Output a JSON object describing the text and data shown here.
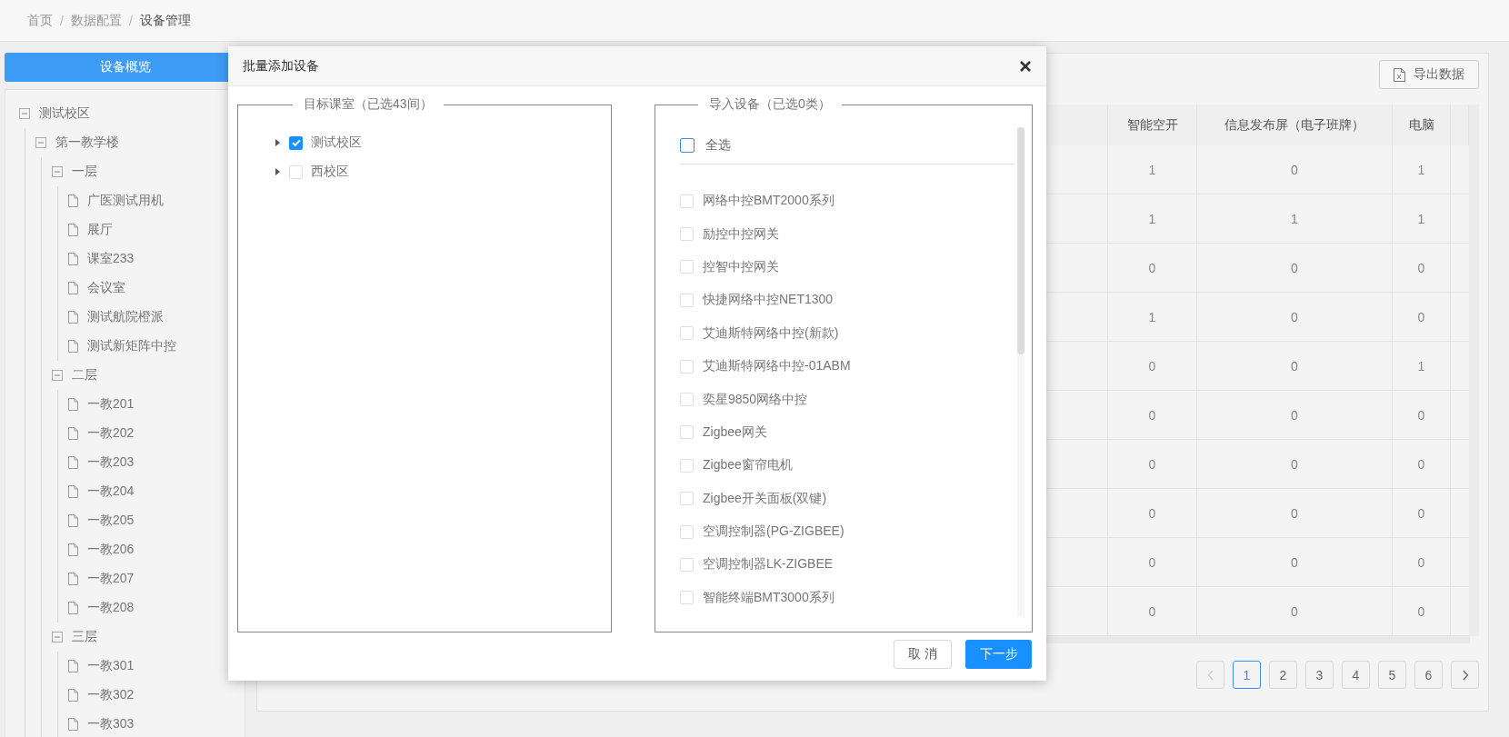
{
  "breadcrumb": [
    {
      "kind": "link",
      "text": "首页"
    },
    {
      "kind": "separator",
      "text": "/"
    },
    {
      "kind": "link",
      "text": "数据配置"
    },
    {
      "kind": "separator",
      "text": "/"
    },
    {
      "kind": "current",
      "text": "设备管理"
    }
  ],
  "sidebar": {
    "button": "设备概览",
    "tree": [
      {
        "label": "测试校区",
        "expanded": true,
        "children": [
          {
            "label": "第一教学楼",
            "expanded": true,
            "children": [
              {
                "label": "一层",
                "expanded": true,
                "children": [
                  {
                    "label": "广医测试用机"
                  },
                  {
                    "label": "展厅"
                  },
                  {
                    "label": "课室233"
                  },
                  {
                    "label": "会议室"
                  },
                  {
                    "label": "测试航院橙派"
                  },
                  {
                    "label": "测试新矩阵中控"
                  }
                ]
              },
              {
                "label": "二层",
                "expanded": true,
                "children": [
                  {
                    "label": "一教201"
                  },
                  {
                    "label": "一教202"
                  },
                  {
                    "label": "一教203"
                  },
                  {
                    "label": "一教204"
                  },
                  {
                    "label": "一教205"
                  },
                  {
                    "label": "一教206"
                  },
                  {
                    "label": "一教207"
                  },
                  {
                    "label": "一教208"
                  }
                ]
              },
              {
                "label": "三层",
                "expanded": true,
                "children": [
                  {
                    "label": "一教301"
                  },
                  {
                    "label": "一教302"
                  },
                  {
                    "label": "一教303"
                  }
                ]
              }
            ]
          }
        ]
      }
    ]
  },
  "panel": {
    "export_button": "导出数据",
    "table": {
      "columns": [
        "智能空开",
        "信息发布屏（电子班牌）",
        "电脑"
      ],
      "rows": [
        [
          "1",
          "0",
          "1"
        ],
        [
          "1",
          "1",
          "1"
        ],
        [
          "0",
          "0",
          "0"
        ],
        [
          "1",
          "0",
          "0"
        ],
        [
          "0",
          "0",
          "1"
        ],
        [
          "0",
          "0",
          "0"
        ],
        [
          "0",
          "0",
          "0"
        ],
        [
          "0",
          "0",
          "0"
        ],
        [
          "0",
          "0",
          "0"
        ],
        [
          "0",
          "0",
          "0"
        ]
      ]
    },
    "pagination": {
      "prev": {
        "disabled": true
      },
      "next": {
        "disabled": false
      },
      "pages": [
        {
          "label": "1",
          "selected": true
        },
        {
          "label": "2",
          "selected": false
        },
        {
          "label": "3",
          "selected": false
        },
        {
          "label": "4",
          "selected": false
        },
        {
          "label": "5",
          "selected": false
        },
        {
          "label": "6",
          "selected": false
        }
      ]
    }
  },
  "modal": {
    "title": "批量添加设备",
    "rooms": {
      "legend": "目标课室（已选43间）",
      "tree": [
        {
          "label": "测试校区",
          "checked": true,
          "expanded": false
        },
        {
          "label": "西校区",
          "checked": false,
          "expanded": false
        }
      ]
    },
    "devices": {
      "legend": "导入设备（已选0类）",
      "select_all": {
        "label": "全选",
        "checked": false
      },
      "items": [
        {
          "label": "网络中控BMT2000系列",
          "checked": false
        },
        {
          "label": "励控中控网关",
          "checked": false
        },
        {
          "label": "控智中控网关",
          "checked": false
        },
        {
          "label": "快捷网络中控NET1300",
          "checked": false
        },
        {
          "label": "艾迪斯特网络中控(新款)",
          "checked": false
        },
        {
          "label": "艾迪斯特网络中控-01ABM",
          "checked": false
        },
        {
          "label": "奕星9850网络中控",
          "checked": false
        },
        {
          "label": "Zigbee网关",
          "checked": false
        },
        {
          "label": "Zigbee窗帘电机",
          "checked": false
        },
        {
          "label": "Zigbee开关面板(双键)",
          "checked": false
        },
        {
          "label": "空调控制器(PG-ZIGBEE)",
          "checked": false
        },
        {
          "label": "空调控制器LK-ZIGBEE",
          "checked": false
        },
        {
          "label": "智能终端BMT3000系列",
          "checked": false
        }
      ]
    },
    "cancel_button": "取 消",
    "next_button": "下一步"
  }
}
